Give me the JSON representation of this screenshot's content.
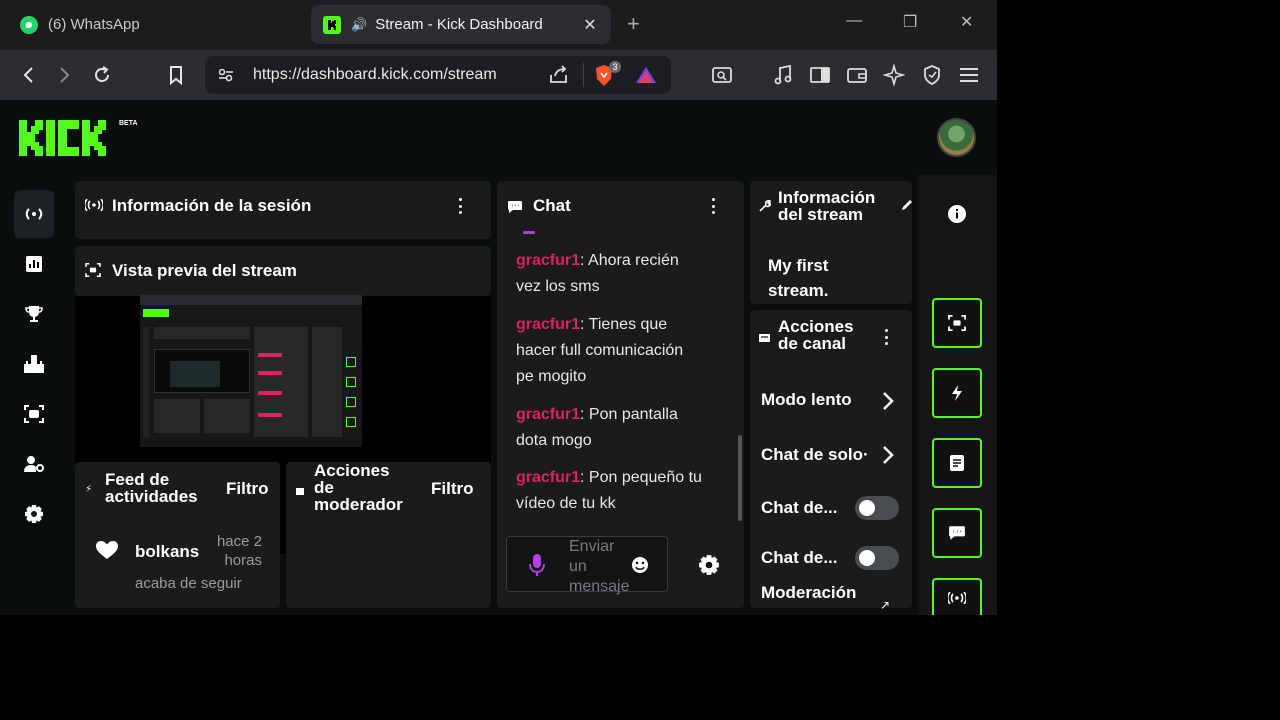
{
  "browser": {
    "tabs": [
      {
        "title": "(6) WhatsApp",
        "active": false
      },
      {
        "title": "Stream - Kick Dashboard",
        "active": true
      }
    ],
    "url": "https://dashboard.kick.com/stream",
    "brave_badge": "3"
  },
  "header": {
    "logo_text": "KICK",
    "logo_badge": "BETA"
  },
  "panels": {
    "session": {
      "title": "Información de la sesión"
    },
    "preview": {
      "title": "Vista previa del stream"
    },
    "activity_feed": {
      "title_line1": "Feed de",
      "title_line2": "actividades",
      "filter": "Filtro",
      "entry": {
        "user": "bolkans",
        "time_line1": "hace 2",
        "time_line2": "horas",
        "action": "acaba de seguir"
      }
    },
    "mod_actions": {
      "title_line1": "Acciones",
      "title_line2": "de",
      "title_line3": "moderador",
      "filter": "Filtro"
    },
    "chat": {
      "title": "Chat",
      "messages": [
        {
          "user": "gracfur1",
          "text_line1": ": Ahora recién",
          "text_line2": "vez los sms",
          "text_line3": ""
        },
        {
          "user": "gracfur1",
          "text_line1": ": Tienes que",
          "text_line2": "hacer full comunicación",
          "text_line3": "pe mogito"
        },
        {
          "user": "gracfur1",
          "text_line1": ": Pon pantalla",
          "text_line2": "dota mogo",
          "text_line3": ""
        },
        {
          "user": "gracfur1",
          "text_line1": ": Pon pequeño tu",
          "text_line2": "vídeo de tu kk",
          "text_line3": ""
        }
      ],
      "input_placeholder_line1": "Enviar",
      "input_placeholder_line2": "un",
      "input_placeholder_line3": "mensaje"
    },
    "stream_info": {
      "title_line1": "Información",
      "title_line2": "del stream",
      "stream_title_line1": "My first",
      "stream_title_line2": "stream."
    },
    "channel_actions": {
      "title_line1": "Acciones",
      "title_line2": "de canal",
      "items": [
        "Modo lento",
        "Chat de solo·",
        "Chat de...",
        "Chat de...",
        "Moderación"
      ]
    }
  },
  "colors": {
    "brand_green": "#53fc18",
    "chat_user": "#e0215a",
    "mic_purple": "#b340e0"
  }
}
